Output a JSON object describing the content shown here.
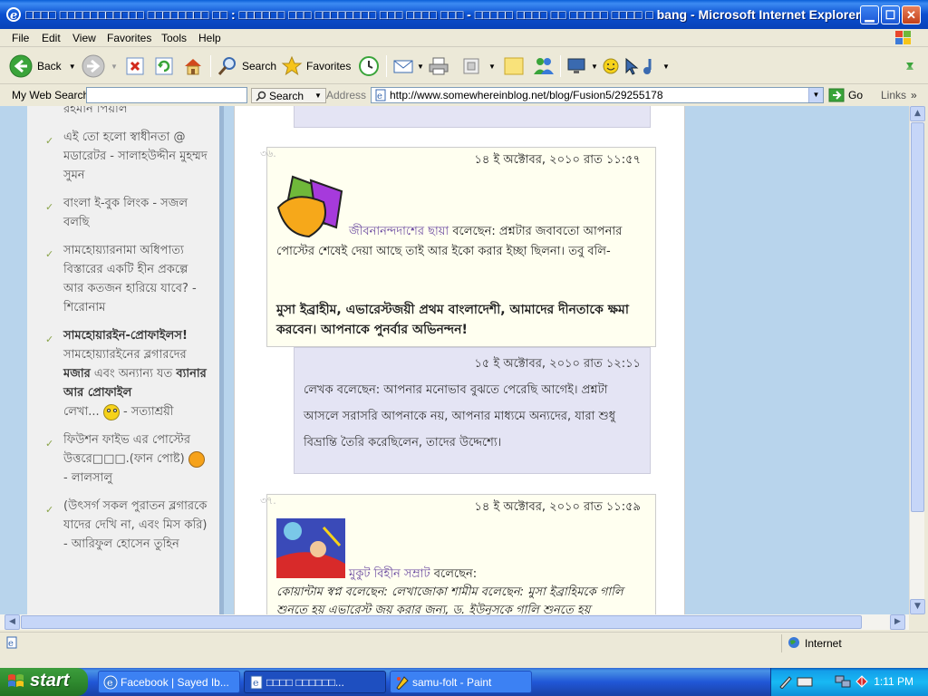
{
  "window": {
    "title": "□□□□ □□□□□□□□□□□ □□□□□□□□ □□ : □□□□□□ □□□ □□□□□□□□ □□□ □□□□ □□□ - □□□□□ □□□□ □□ □□□□□ □□□□ □ bang - Microsoft Internet Explorer"
  },
  "menu": [
    "File",
    "Edit",
    "View",
    "Favorites",
    "Tools",
    "Help"
  ],
  "toolbar": {
    "back_label": "Back",
    "search_label": "Search",
    "favorites_label": "Favorites"
  },
  "addressbar": {
    "mysearch_label": "My Web Search",
    "search_btn_label": "Search",
    "address_label": "Address",
    "url": "http://www.somewhereinblog.net/blog/Fusion5/29255178",
    "go_label": "Go",
    "links_label": "Links"
  },
  "sidebar": {
    "top_fragment": "রহমান পিয়াল",
    "items": [
      {
        "text": "এই তো হলো স্বাধীনতা @ মডারেটর - সালাহউদ্দীন মুহম্মদ সুমন"
      },
      {
        "text": "বাংলা ই-বুক লিংক - সজল বলছি"
      },
      {
        "text": "সামহোয়্যারনামা অধিপাত্য বিস্তারের একটি হীন প্রকল্পে আর কতজন হারিয়ে যাবে? - শিরোনাম"
      },
      {
        "bold_title": "সামহোয়ারইন-প্রোফাইলস!",
        "pre": "সামহোয়্যারইনের ব্লগারদের ",
        "b1": "মজার",
        "mid": " এবং অন্যান্য যত ",
        "b2": "ব্যানার আর প্রোফাইল",
        "post": " লেখা...",
        "author": " - সত্যাশ্রয়ী"
      },
      {
        "text": "ফিউশন ফাইভ এর পোস্টের উত্তরে□□□.(ফান পোষ্ট)",
        "author": " - লালসালু"
      },
      {
        "text": "(উৎসর্গ সকল পুরাতন ব্লগারকে যাদের দেখি না, এবং মিস করি) - আরিফুল হোসেন তুহিন"
      }
    ]
  },
  "comments": [
    {
      "number": "৩৬.",
      "date": "১৪ ই অক্টোবর, ২০১০ রাত ১১:৫৭",
      "author": "জীবনানন্দদাশের ছায়া",
      "said": " বলেছেন: ",
      "text": "প্রশ্নটার জবাবতো আপনার পোস্টের শেষেই দেয়া আছে তাই আর ইকো করার ইচ্ছা ছিলনা। তবু বলি-",
      "bold": "মুসা ইব্রাহীম, এভারেস্টজয়ী প্রথম বাংলাদেশী, আমাদের দীনতাকে ক্ষমা করবেন। আপনাকে পুনর্বার অভিনন্দন!"
    },
    {
      "number": "৩৭.",
      "date": "১৪ ই অক্টোবর, ২০১০ রাত ১১:৫৯",
      "author": "মুকুট বিহীন সম্রাট",
      "said": " বলেছেন:",
      "text": "কোয়ান্টাম স্বপ্ন বলেছেন: লেখাজোকা শামীম বলেছেন: মুসা ইব্রাহিমকে গালি শুনতে হয় এভারেস্ট জয় করার জন্য, ড. ইউনুসকে গালি শুনতে হয়"
    }
  ],
  "reply": {
    "date": "১৫ ই অক্টোবর, ২০১০ রাত ১২:১১",
    "text": "লেখক বলেছেন: আপনার মনোভাব বুঝতে পেরেছি আগেই। প্রশ্নটা আসলে সরাসরি আপনাকে নয়, আপনার মাধ্যমে অন্যদের, যারা শুধু বিভ্রান্তি তৈরি করেছিলেন, তাদের উদ্দেশ্যে।"
  },
  "status": {
    "zone": "Internet"
  },
  "taskbar": {
    "start_label": "start",
    "tasks": [
      {
        "label": "Facebook | Sayed Ib..."
      },
      {
        "label": "□□□□ □□□□□□..."
      },
      {
        "label": "samu-folt - Paint"
      }
    ],
    "clock": "1:11 PM"
  }
}
